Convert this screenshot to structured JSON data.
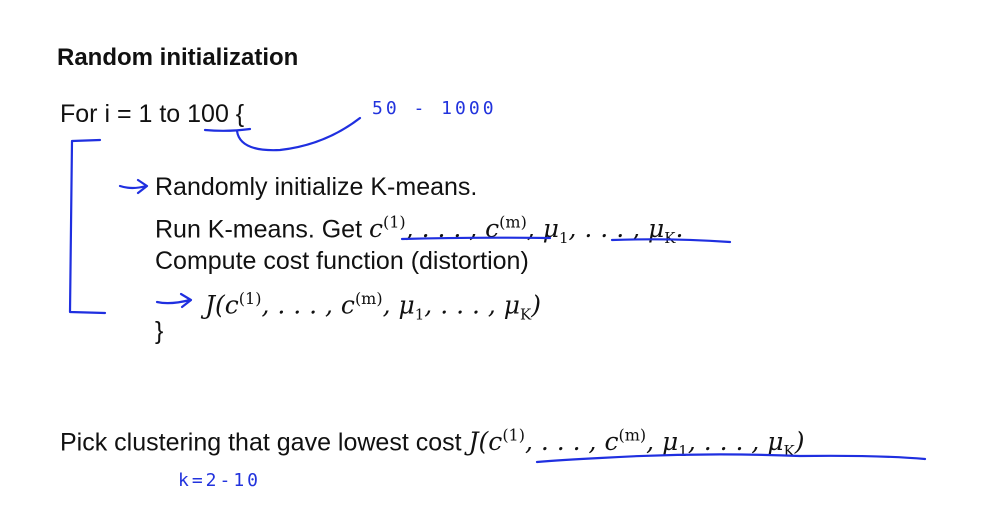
{
  "title": "Random initialization",
  "for_line": {
    "prefix": "For i = 1 to ",
    "count": "100",
    "suffix": " {"
  },
  "loop": {
    "line1": "Randomly initialize K-means.",
    "line2_text": "Run K-means. Get ",
    "line2_math": {
      "c1": "c",
      "sup1": "(1)",
      "dots": ", . . . , ",
      "cm": "c",
      "supm": "(m)",
      "mu1": ", μ",
      "sub1": "1",
      "dots2": ", . . . , μ",
      "subK": "K",
      "end": "."
    },
    "line3": "Compute cost function (distortion)",
    "line4_math": {
      "J": "J(c",
      "sup1": "(1)",
      "dots": ", . . . , c",
      "supm": "(m)",
      "mu": ", μ",
      "sub1": "1",
      "dots2": ", . . . , μ",
      "subK": "K",
      "end": ")"
    },
    "close": "}"
  },
  "pick": {
    "text": "Pick clustering that gave lowest cost ",
    "math": {
      "J": "J(c",
      "sup1": "(1)",
      "dots": ", . . . , c",
      "supm": "(m)",
      "mu": ", μ",
      "sub1": "1",
      "dots2": ", . . . , μ",
      "subK": "K",
      "end": ")"
    }
  },
  "annotations": {
    "iterations_range": "50 - 1000",
    "k_range": "k=2-10"
  },
  "colors": {
    "ink": "#1f2fe0",
    "text": "#111111"
  }
}
